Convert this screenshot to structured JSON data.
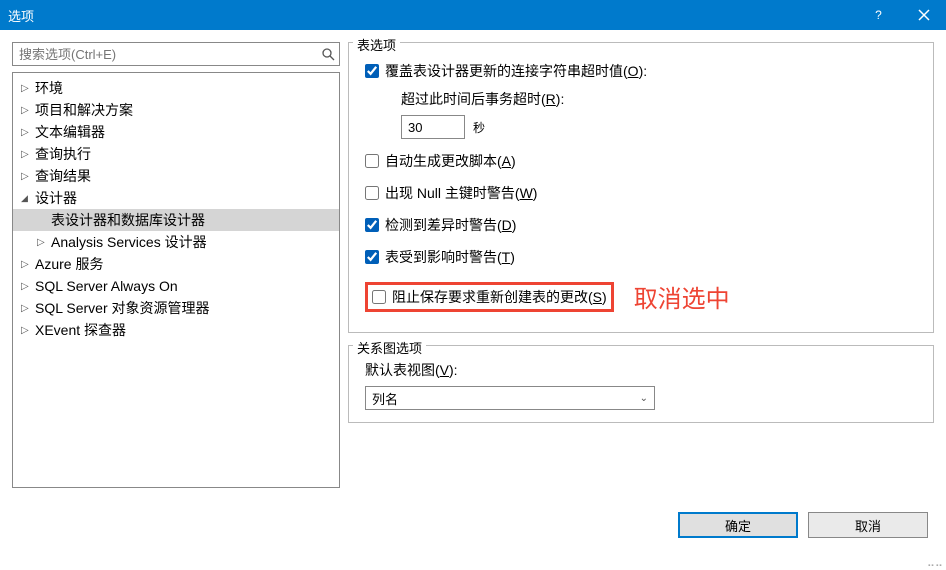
{
  "window": {
    "title": "选项"
  },
  "search": {
    "placeholder": "搜索选项(Ctrl+E)"
  },
  "tree": {
    "items": [
      {
        "label": "环境",
        "expanded": false
      },
      {
        "label": "项目和解决方案",
        "expanded": false
      },
      {
        "label": "文本编辑器",
        "expanded": false
      },
      {
        "label": "查询执行",
        "expanded": false
      },
      {
        "label": "查询结果",
        "expanded": false
      },
      {
        "label": "设计器",
        "expanded": true,
        "children": [
          {
            "label": "表设计器和数据库设计器",
            "selected": true
          },
          {
            "label": "Analysis Services 设计器",
            "hasArrow": true
          }
        ]
      },
      {
        "label": "Azure 服务",
        "expanded": false
      },
      {
        "label": "SQL Server Always On",
        "expanded": false
      },
      {
        "label": "SQL Server 对象资源管理器",
        "expanded": false
      },
      {
        "label": "XEvent 探查器",
        "expanded": false
      }
    ]
  },
  "tableOptions": {
    "legend": "表选项",
    "overrideConn": {
      "label_pre": "覆盖表设计器更新的连接字符串超时值(",
      "key": "O",
      "label_post": "):",
      "checked": true
    },
    "timeoutLabel": {
      "pre": "超过此时间后事务超时(",
      "key": "R",
      "post": "):"
    },
    "timeoutValue": "30",
    "timeoutUnit": "秒",
    "autoGen": {
      "label_pre": "自动生成更改脚本(",
      "key": "A",
      "label_post": ")",
      "checked": false
    },
    "nullWarn": {
      "label_pre": "出现 Null 主键时警告(",
      "key": "W",
      "label_post": ")",
      "checked": false
    },
    "diffWarn": {
      "label_pre": "检测到差异时警告(",
      "key": "D",
      "label_post": ")",
      "checked": true
    },
    "affectWarn": {
      "label_pre": "表受到影响时警告(",
      "key": "T",
      "label_post": ")",
      "checked": true
    },
    "preventSave": {
      "label_pre": "阻止保存要求重新创建表的更改(",
      "key": "S",
      "label_post": ")",
      "checked": false
    }
  },
  "annotation": "取消选中",
  "diagramOptions": {
    "legend": "关系图选项",
    "defaultViewLabel": {
      "pre": "默认表视图(",
      "key": "V",
      "post": "):"
    },
    "selectedView": "列名"
  },
  "buttons": {
    "ok": "确定",
    "cancel": "取消"
  }
}
